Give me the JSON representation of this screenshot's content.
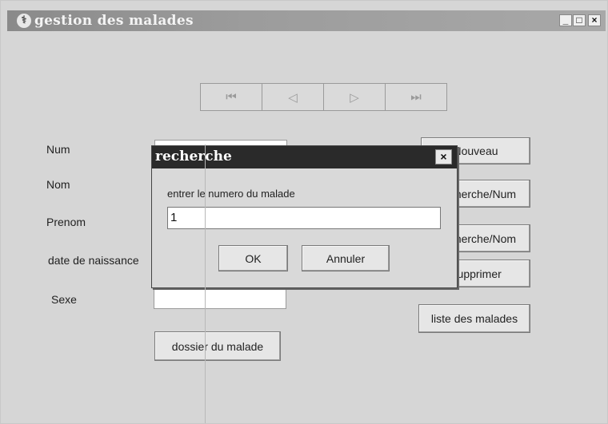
{
  "window": {
    "title": "gestion des malades",
    "minimize": "_",
    "maximize": "□",
    "close": "×"
  },
  "nav": {
    "first": "⏮",
    "prev": "◁",
    "next": "▷",
    "last": "⏭"
  },
  "form": {
    "num_label": "Num",
    "nom_label": "Nom",
    "prenom_label": "Prenom",
    "date_label": "date de naissance",
    "sexe_label": "Sexe",
    "dossier_button": "dossier du malade"
  },
  "actions": {
    "nouveau": "Nouveau",
    "recherche_num": "Recherche/Num",
    "recherche_nom": "Recherche/Nom",
    "supprimer": "Supprimer",
    "liste": "liste des malades"
  },
  "dialog": {
    "title": "recherche",
    "close": "×",
    "prompt": "entrer le numero du malade",
    "input_value": "1",
    "ok": "OK",
    "cancel": "Annuler"
  }
}
